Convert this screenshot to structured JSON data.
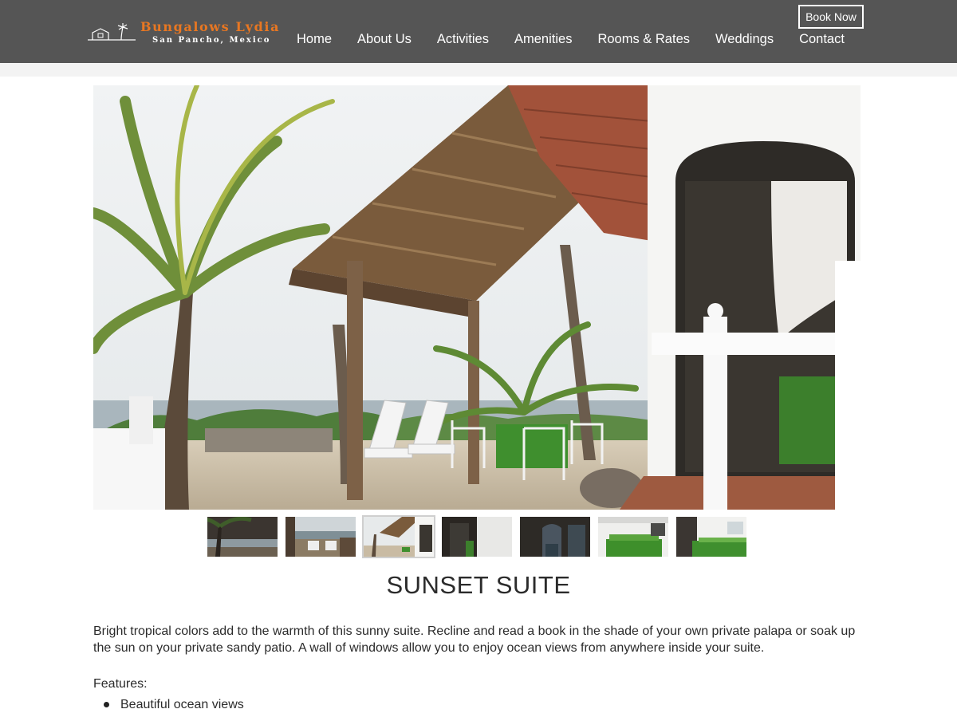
{
  "brand": {
    "name": "Bungalows Lydia",
    "location": "San Pancho, Mexico",
    "accent_color": "#e87722",
    "header_color": "#555555"
  },
  "nav": {
    "items": [
      {
        "label": "Home"
      },
      {
        "label": "About Us"
      },
      {
        "label": "Activities"
      },
      {
        "label": "Amenities"
      },
      {
        "label": "Rooms & Rates"
      },
      {
        "label": "Weddings"
      },
      {
        "label": "Contact"
      }
    ],
    "book_now": "Book Now"
  },
  "gallery": {
    "main_image": "photo-palapa-patio",
    "thumbnails": [
      {
        "name": "thumb-palm-beach"
      },
      {
        "name": "thumb-ocean-loungers"
      },
      {
        "name": "thumb-palapa-patio",
        "active": true
      },
      {
        "name": "thumb-interior-door"
      },
      {
        "name": "thumb-bedroom-doorway"
      },
      {
        "name": "thumb-green-bed"
      },
      {
        "name": "thumb-bedroom-window"
      }
    ]
  },
  "room": {
    "title": "SUNSET SUITE",
    "description": "Bright tropical colors add to the warmth of this sunny suite. Recline and read a book in the shade of your own private palapa or soak up the sun on your private sandy patio. A wall of windows allow you to enjoy ocean views from anywhere inside your suite.",
    "features_label": "Features:",
    "features": [
      "Beautiful ocean views"
    ]
  }
}
